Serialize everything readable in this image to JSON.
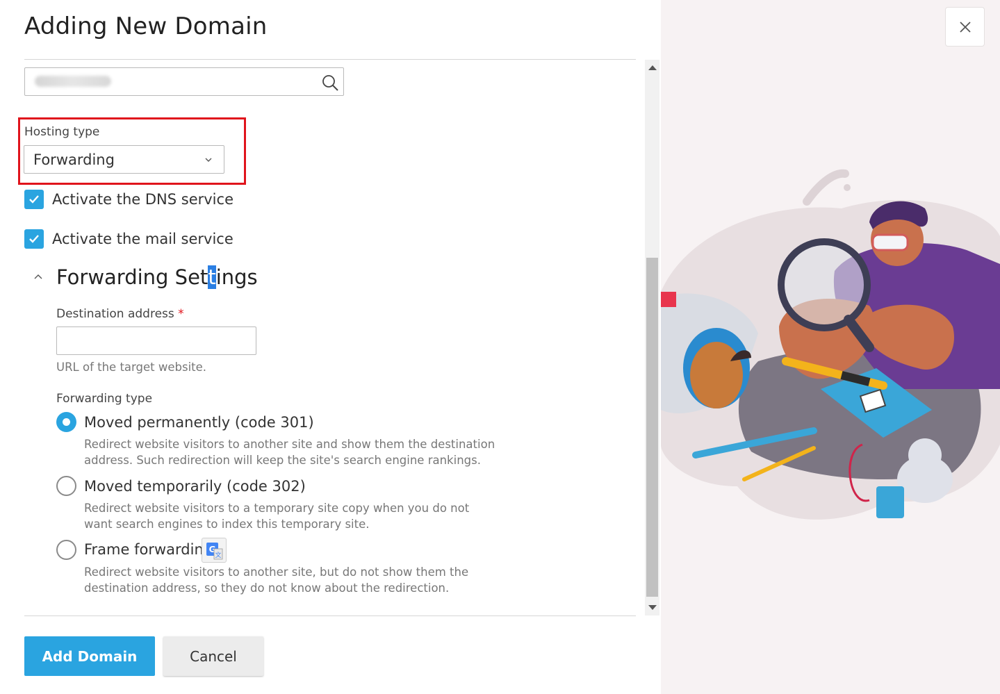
{
  "dialog": {
    "title": "Adding New Domain",
    "close_icon": "close-icon"
  },
  "domain_search": {
    "value": "mainkit.id",
    "icon": "search-icon"
  },
  "hosting_type": {
    "label": "Hosting type",
    "selected": "Forwarding",
    "icon": "chevron-down-icon"
  },
  "checkboxes": [
    {
      "label": "Activate the DNS service",
      "checked": true
    },
    {
      "label": "Activate the mail service",
      "checked": true
    }
  ],
  "forwarding_settings": {
    "title_before": "Forwarding Set",
    "title_cursor": "t",
    "title_after": "ings",
    "destination_label": "Destination address",
    "required_mark": "*",
    "destination_value": "",
    "destination_hint": "URL of the target website.",
    "forwarding_type_label": "Forwarding type",
    "options": [
      {
        "label": "Moved permanently (code 301)",
        "selected": true,
        "desc_line1": "Redirect website visitors to another site and show them the destination",
        "desc_line2": "address. Such redirection will keep the site's search engine rankings."
      },
      {
        "label": "Moved temporarily (code 302)",
        "selected": false,
        "desc_line1": "Redirect website visitors to a temporary site copy when you do not",
        "desc_line2": "want search engines to index this temporary site."
      },
      {
        "label": "Frame forwardin",
        "selected": false,
        "desc_line1": "Redirect website visitors to another site, but do not show them the",
        "desc_line2": "destination address, so they do not know about the redirection."
      }
    ]
  },
  "buttons": {
    "add_domain": "Add Domain",
    "cancel": "Cancel"
  },
  "colors": {
    "accent": "#2aa4e0",
    "highlight": "#e0141c"
  }
}
